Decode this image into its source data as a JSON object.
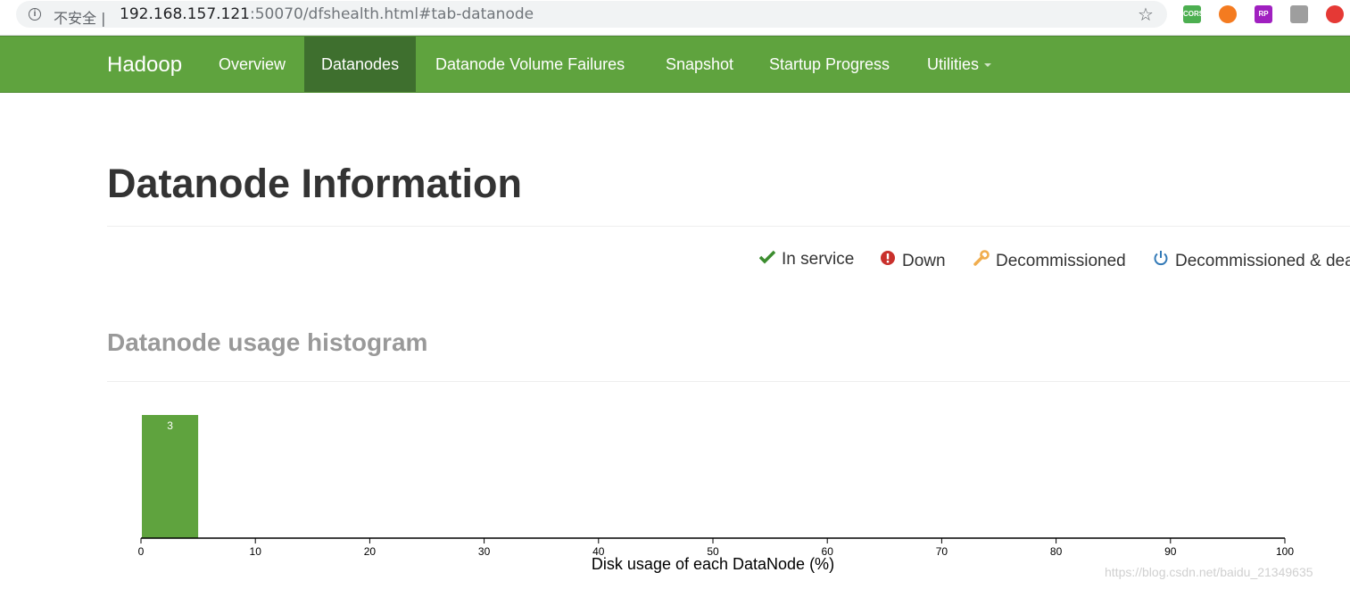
{
  "browser": {
    "security_label": "不安全",
    "url_host": "192.168.157.121",
    "url_rest": ":50070/dfshealth.html#tab-datanode",
    "extensions": [
      {
        "name": "cors-extension-icon",
        "label": "CORS",
        "color": "#4caf50"
      },
      {
        "name": "lifebuoy-extension-icon",
        "label": "",
        "color": "#f47b20"
      },
      {
        "name": "rp-extension-icon",
        "label": "RP",
        "color": "#a020c0"
      },
      {
        "name": "sitemap-extension-icon",
        "label": "",
        "color": "#9e9e9e"
      },
      {
        "name": "location-pin-extension-icon",
        "label": "",
        "color": "#e53935"
      }
    ]
  },
  "navbar": {
    "brand": "Hadoop",
    "items": [
      {
        "label": "Overview",
        "active": false
      },
      {
        "label": "Datanodes",
        "active": true
      },
      {
        "label": "Datanode Volume Failures",
        "active": false
      },
      {
        "label": "Snapshot",
        "active": false
      },
      {
        "label": "Startup Progress",
        "active": false
      },
      {
        "label": "Utilities",
        "active": false,
        "dropdown": true
      }
    ]
  },
  "page": {
    "title": "Datanode Information",
    "histogram_title": "Datanode usage histogram"
  },
  "legend": [
    {
      "label": "In service",
      "icon": "check-icon",
      "color": "#3c8d2f"
    },
    {
      "label": "Down",
      "icon": "exclamation-circle-icon",
      "color": "#c9302c"
    },
    {
      "label": "Decommissioned",
      "icon": "wrench-icon",
      "color": "#f0ad4e"
    },
    {
      "label": "Decommissioned & dead",
      "icon": "power-icon",
      "color": "#337ab7"
    }
  ],
  "chart_data": {
    "type": "bar",
    "title": "",
    "xlabel": "Disk usage of each DataNode (%)",
    "ylabel": "",
    "xlim": [
      0,
      100
    ],
    "x_ticks": [
      0,
      10,
      20,
      30,
      40,
      50,
      60,
      70,
      80,
      90,
      100
    ],
    "bins": [
      {
        "x0": 0,
        "x1": 5,
        "value": 3
      }
    ],
    "bar_color": "#5fa33e",
    "grid": false
  },
  "watermark": "https://blog.csdn.net/baidu_21349635"
}
